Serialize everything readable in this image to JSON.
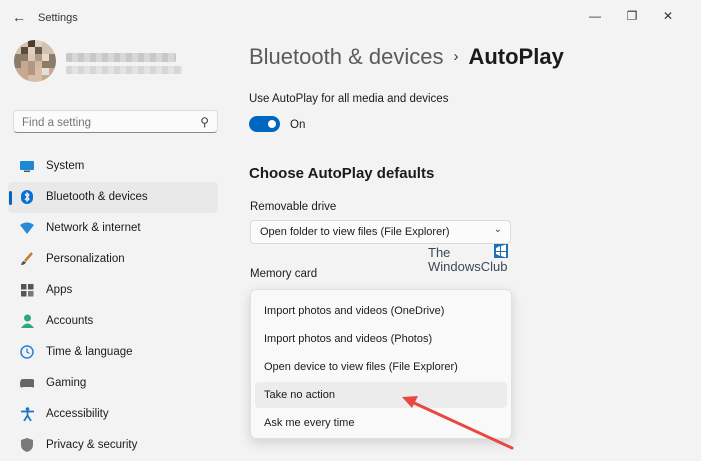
{
  "window": {
    "title": "Settings",
    "minimize": "—",
    "maximize": "❐",
    "close": "✕",
    "back": "←"
  },
  "search": {
    "placeholder": "Find a setting"
  },
  "sidebar": {
    "items": [
      {
        "label": "System",
        "icon": "system-icon",
        "active": false
      },
      {
        "label": "Bluetooth & devices",
        "icon": "bluetooth-icon",
        "active": true
      },
      {
        "label": "Network & internet",
        "icon": "network-icon",
        "active": false
      },
      {
        "label": "Personalization",
        "icon": "brush-icon",
        "active": false
      },
      {
        "label": "Apps",
        "icon": "apps-icon",
        "active": false
      },
      {
        "label": "Accounts",
        "icon": "accounts-icon",
        "active": false
      },
      {
        "label": "Time & language",
        "icon": "time-language-icon",
        "active": false
      },
      {
        "label": "Gaming",
        "icon": "gaming-icon",
        "active": false
      },
      {
        "label": "Accessibility",
        "icon": "accessibility-icon",
        "active": false
      },
      {
        "label": "Privacy & security",
        "icon": "shield-icon",
        "active": false
      }
    ]
  },
  "breadcrumb": {
    "parent": "Bluetooth & devices",
    "separator": "›",
    "current": "AutoPlay"
  },
  "autoplay": {
    "label": "Use AutoPlay for all media and devices",
    "toggle_state": "On"
  },
  "defaults": {
    "heading": "Choose AutoPlay defaults",
    "removable_label": "Removable drive",
    "removable_value": "Open folder to view files (File Explorer)",
    "memory_label": "Memory card",
    "memory_options": [
      "Import photos and videos (OneDrive)",
      "Import photos and videos (Photos)",
      "Open device to view files (File Explorer)",
      "Take no action",
      "Ask me every time"
    ]
  },
  "watermark": {
    "line1": "The",
    "line2": "WindowsClub"
  },
  "colors": {
    "accent": "#0067c0",
    "arrow": "#e8483f"
  }
}
